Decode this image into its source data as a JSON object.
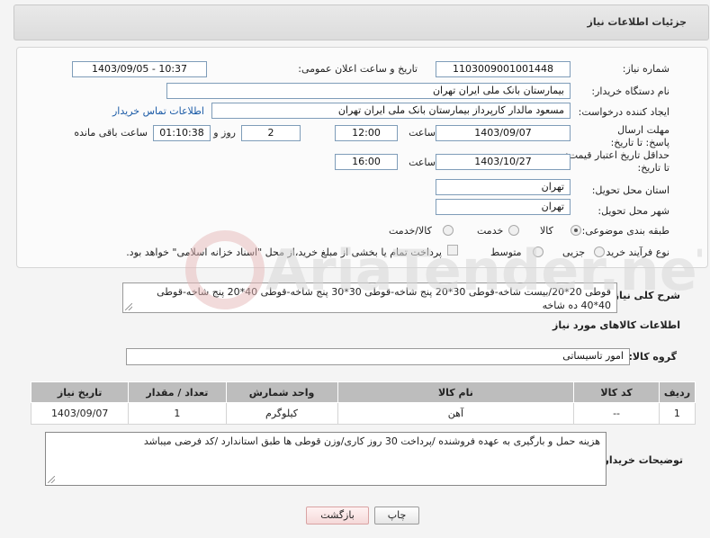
{
  "header": {
    "title": "جزئیات اطلاعات نیاز"
  },
  "fields": {
    "need_number": {
      "label": "شماره نیاز:",
      "value": "1103009001001448"
    },
    "announce_datetime": {
      "label": "تاریخ و ساعت اعلان عمومی:",
      "value": "1403/09/05 - 10:37"
    },
    "buyer_org": {
      "label": "نام دستگاه خریدار:",
      "value": "بیمارستان بانک ملی ایران تهران"
    },
    "requester": {
      "label": "ایجاد کننده درخواست:",
      "value": "مسعود مالدار کارپرداز بیمارستان بانک ملی ایران تهران",
      "link": "اطلاعات تماس خریدار"
    },
    "reply_deadline": {
      "label": "مهلت ارسال پاسخ: تا تاریخ:",
      "date": "1403/09/07",
      "time_label": "ساعت",
      "time": "12:00",
      "days": "2",
      "days_label": "روز و",
      "remaining": "01:10:38",
      "remaining_label": "ساعت باقی مانده"
    },
    "price_validity": {
      "label": "حداقل تاریخ اعتبار قیمت: تا تاریخ:",
      "date": "1403/10/27",
      "time_label": "ساعت",
      "time": "16:00"
    },
    "delivery_province": {
      "label": "استان محل تحویل:",
      "value": "تهران"
    },
    "delivery_city": {
      "label": "شهر محل تحویل:",
      "value": "تهران"
    },
    "category": {
      "label": "طبقه بندی موضوعی:",
      "options": [
        "کالا",
        "خدمت",
        "کالا/خدمت"
      ],
      "selected": "کالا"
    },
    "purchase_process": {
      "label": "نوع فرآیند خرید :",
      "options": [
        "جزیی",
        "متوسط"
      ],
      "payment_text": "پرداخت تمام یا بخشی از مبلغ خرید،از محل \"اسناد خزانه اسلامی\" خواهد بود."
    }
  },
  "general_description": {
    "label": "شرح کلی نیاز:",
    "value": "قوطی 20*20/بیست شاخه-قوطی 30*20 پنج شاخه-قوطی 30*30 پنج شاخه-قوطی 40*20 پنج شاخه-قوطی 40*40 ده شاخه"
  },
  "goods_info": {
    "title": "اطلاعات کالاهای مورد نیاز",
    "group_label": "گروه کالا:",
    "group_value": "امور تاسیساتی"
  },
  "table": {
    "headers": [
      "ردیف",
      "کد کالا",
      "نام کالا",
      "واحد شمارش",
      "تعداد / مقدار",
      "تاریخ نیاز"
    ],
    "rows": [
      [
        "1",
        "--",
        "آهن",
        "کیلوگرم",
        "1",
        "1403/09/07"
      ]
    ]
  },
  "buyer_notes": {
    "label": "توضیحات خریدار:",
    "value": "هزینه حمل و بارگیری  به عهده فروشنده /پرداخت 30 روز کاری/وزن قوطی ها طبق استاندارد /کد فرضی میباشد"
  },
  "buttons": {
    "print": "چاپ",
    "back": "بازگشت"
  },
  "watermark_text": "AriaTender.neT"
}
